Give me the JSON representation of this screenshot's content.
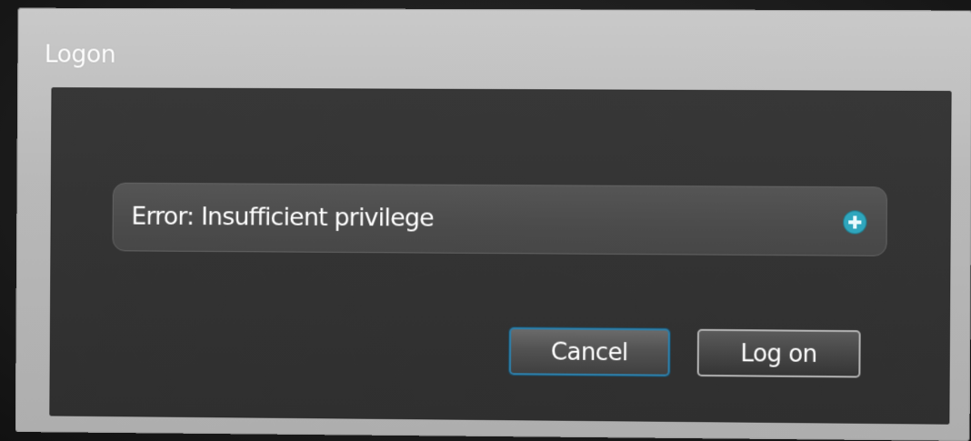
{
  "dialog": {
    "title": "Logon",
    "error_message": "Error: Insufficient privilege",
    "details_icon": "plus-circle-icon",
    "buttons": {
      "cancel_label": "Cancel",
      "logon_label": "Log on"
    },
    "colors": {
      "frame": "#c0c0c0",
      "panel": "#333333",
      "error_box": "#4d4d4d",
      "focus_border": "#2e7ea8",
      "icon_accent": "#2fa6bd"
    }
  }
}
